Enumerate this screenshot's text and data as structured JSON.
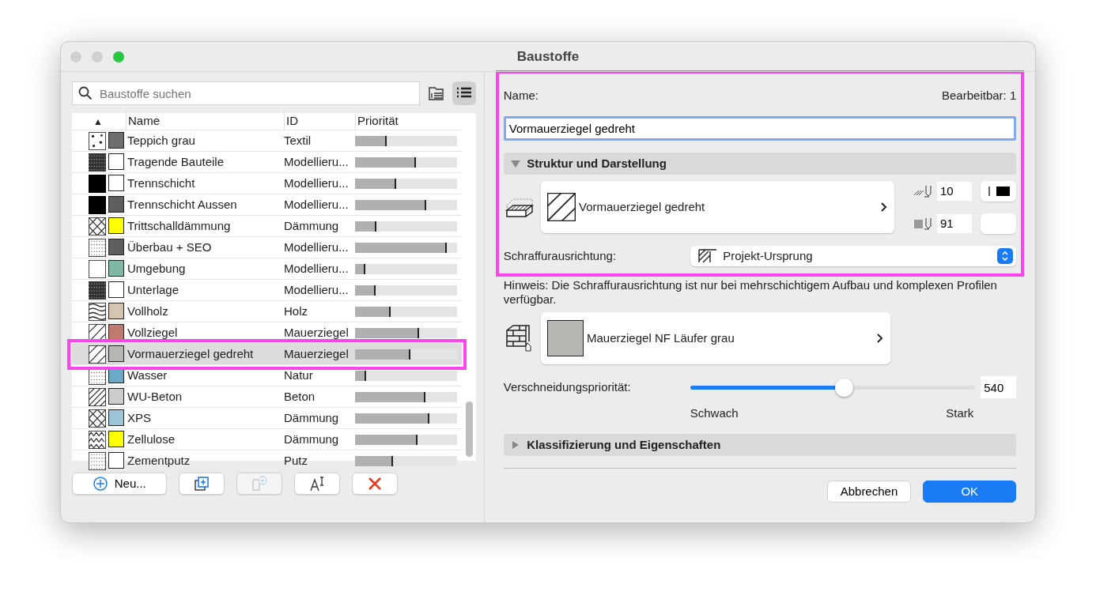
{
  "window": {
    "title": "Baustoffe"
  },
  "search": {
    "placeholder": "Baustoffe suchen"
  },
  "view_buttons": [
    {
      "kind": "tree",
      "selected": false
    },
    {
      "kind": "list",
      "selected": true
    }
  ],
  "table": {
    "sort_indicator": "▲",
    "columns": [
      "Name",
      "ID",
      "Priorität"
    ],
    "rows": [
      {
        "name": "Teppich grau",
        "id": "Textil",
        "kind": "dots",
        "color": "#6e6e6e",
        "level": 0.31,
        "selected": false,
        "highlighted": false
      },
      {
        "name": "Tragende Bauteile",
        "id": "Modellieru...",
        "kind": "dense",
        "color": "#ffffff",
        "level": 0.6,
        "selected": false,
        "highlighted": false
      },
      {
        "name": "Trennschicht",
        "id": "Modellieru...",
        "kind": "solid",
        "color": "#ffffff",
        "level": 0.4,
        "selected": false,
        "highlighted": false
      },
      {
        "name": "Trennschicht Aussen",
        "id": "Modellieru...",
        "kind": "solid",
        "color": "#5e5e5e",
        "level": 0.7,
        "selected": false,
        "highlighted": false
      },
      {
        "name": "Trittschalldämmung",
        "id": "Dämmung",
        "kind": "cross",
        "color": "#ffff00",
        "level": 0.21,
        "selected": false,
        "highlighted": false
      },
      {
        "name": "Überbau + SEO",
        "id": "Modellieru...",
        "kind": "fine",
        "color": "#5e5e5e",
        "level": 0.9,
        "selected": false,
        "highlighted": false
      },
      {
        "name": "Umgebung",
        "id": "Modellieru...",
        "kind": "empty",
        "color": "#7fb8a4",
        "level": 0.1,
        "selected": false,
        "highlighted": false
      },
      {
        "name": "Unterlage",
        "id": "Modellieru...",
        "kind": "dense",
        "color": "#ffffff",
        "level": 0.2,
        "selected": false,
        "highlighted": false
      },
      {
        "name": "Vollholz",
        "id": "Holz",
        "kind": "wave",
        "color": "#d4c4b0",
        "level": 0.35,
        "selected": false,
        "highlighted": false
      },
      {
        "name": "Vollziegel",
        "id": "Mauerziegel",
        "kind": "diagonal",
        "color": "#c07a70",
        "level": 0.63,
        "selected": false,
        "highlighted": false
      },
      {
        "name": "Vormauerziegel gedreht",
        "id": "Mauerziegel",
        "kind": "diagonal",
        "color": "#b8b6b2",
        "level": 0.54,
        "selected": true,
        "highlighted": true
      },
      {
        "name": "Wasser",
        "id": "Natur",
        "kind": "fine",
        "color": "#6aaac8",
        "level": 0.11,
        "selected": false,
        "highlighted": false
      },
      {
        "name": "WU-Beton",
        "id": "Beton",
        "kind": "hatch",
        "color": "#cccccc",
        "level": 0.69,
        "selected": false,
        "highlighted": false
      },
      {
        "name": "XPS",
        "id": "Dämmung",
        "kind": "cross",
        "color": "#9cc4d8",
        "level": 0.73,
        "selected": false,
        "highlighted": false
      },
      {
        "name": "Zellulose",
        "id": "Dämmung",
        "kind": "zigzag",
        "color": "#ffff00",
        "level": 0.61,
        "selected": false,
        "highlighted": false
      },
      {
        "name": "Zementputz",
        "id": "Putz",
        "kind": "fine",
        "color": "#ffffff",
        "level": 0.37,
        "selected": false,
        "highlighted": false
      }
    ]
  },
  "toolbar_buttons": [
    {
      "kind": "new",
      "label": "Neu...",
      "disabled": false
    },
    {
      "kind": "duplicate",
      "disabled": false
    },
    {
      "kind": "folder",
      "disabled": true
    },
    {
      "kind": "rename",
      "disabled": false
    },
    {
      "kind": "delete",
      "disabled": false
    }
  ],
  "details": {
    "highlighted": true,
    "name_label": "Name:",
    "editable": "Bearbeitbar: 1",
    "name_value": "Vormauerziegel gedreht",
    "structure_section": {
      "title": "Struktur und Darstellung",
      "expanded": true
    },
    "hatch": {
      "kind": "diagonal",
      "label": "Vormauerziegel gedreht"
    },
    "pens": [
      {
        "kind": "hatch",
        "value": "10"
      },
      {
        "kind": "fill",
        "value": "91"
      }
    ],
    "orientation": {
      "label": "Schraffurausrichtung:",
      "value": "Projekt-Ursprung"
    }
  },
  "hint": "Hinweis: Die Schraffurausrichtung ist nur bei mehrschichtigem Aufbau und komplexen Profilen verfügbar.",
  "surface": {
    "color": "#b8b6b2",
    "label": "Mauerziegel NF Läufer grau"
  },
  "priority": {
    "label": "Verschneidungspriorität:",
    "level": 0.54,
    "value": "540",
    "min_label": "Schwach",
    "max_label": "Stark"
  },
  "classification": {
    "title": "Klassifizierung und Eigenschaften",
    "expanded": false
  },
  "buttons": [
    {
      "label": "Abbrechen",
      "primary": false
    },
    {
      "label": "OK",
      "primary": true
    }
  ]
}
